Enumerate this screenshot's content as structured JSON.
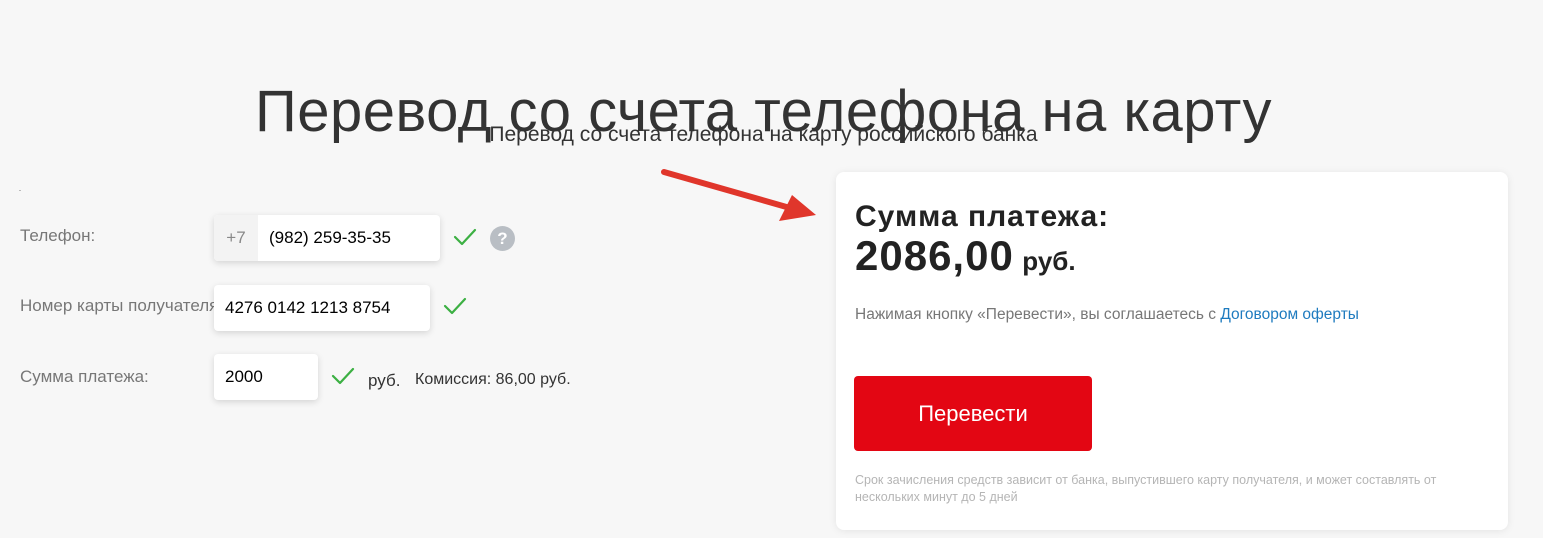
{
  "header": {
    "title": "Перевод со счета телефона на карту",
    "subtitle": "Перевод со счета телефона на карту российского банка"
  },
  "form": {
    "phone": {
      "label": "Телефон:",
      "prefix": "+7",
      "value": "(982) 259-35-35",
      "help_symbol": "?"
    },
    "card_number": {
      "label": "Номер карты получателя:",
      "value": "4276 0142 1213 8754"
    },
    "amount": {
      "label": "Сумма платежа:",
      "value": "2000",
      "unit": "руб.",
      "commission": "Комиссия: 86,00 руб."
    }
  },
  "summary": {
    "label": "Сумма платежа:",
    "amount": "2086,00",
    "currency": "руб.",
    "agreement_prefix": "Нажимая кнопку «Перевести», вы соглашаетесь с ",
    "agreement_link": "Договором оферты",
    "button_label": "Перевести",
    "note": "Срок зачисления средств зависит от банка, выпустившего карту получателя, и может составлять от нескольких минут до 5 дней"
  },
  "colors": {
    "accent_red": "#e30613",
    "link_blue": "#1e7bbf",
    "check_green": "#3cb043",
    "arrow_red": "#e0362b"
  },
  "icons": {
    "check": "check-icon",
    "help": "help-icon",
    "arrow": "arrow-icon"
  }
}
